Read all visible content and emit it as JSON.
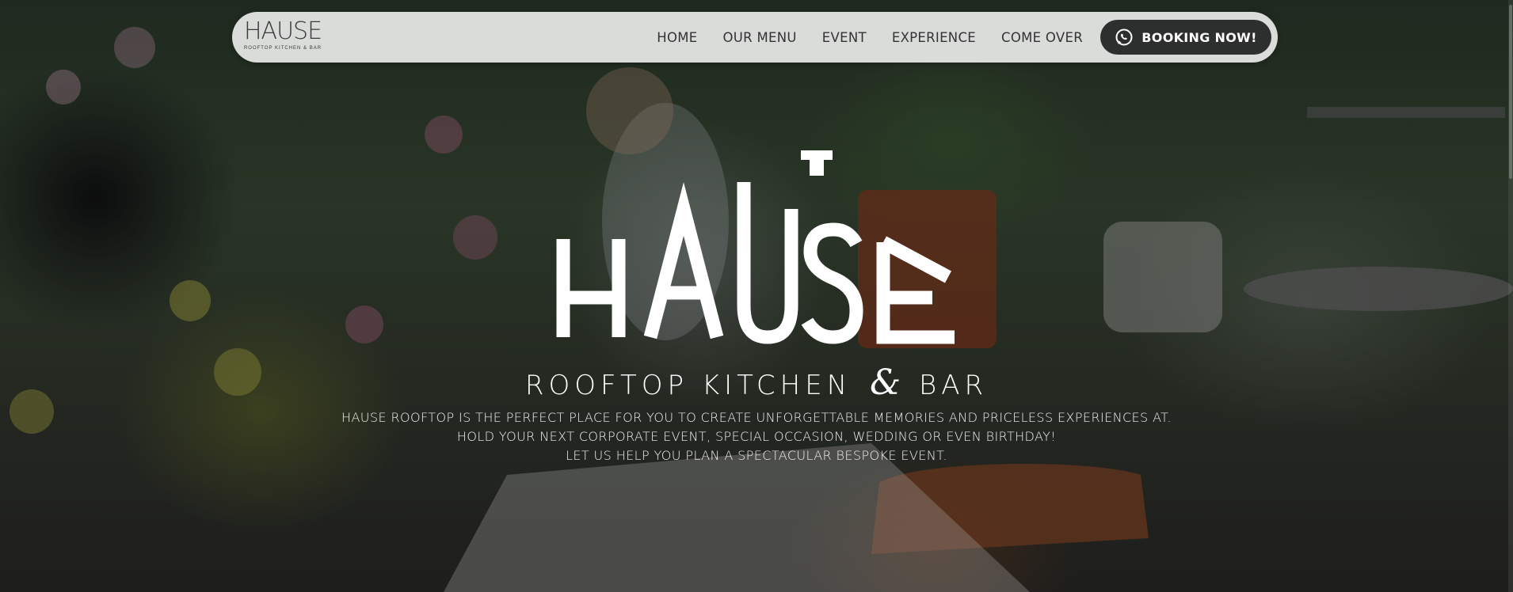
{
  "brand": {
    "name": "HAUSE",
    "tagline_prefix": "ROOFTOP KITCHEN",
    "tagline_amp": "&",
    "tagline_suffix": "BAR",
    "nav_tagline": "ROOFTOP KITCHEN & BAR"
  },
  "nav": {
    "links": [
      "HOME",
      "OUR MENU",
      "EVENT",
      "EXPERIENCE",
      "COME OVER"
    ],
    "booking_label": "BOOKING NOW!",
    "booking_icon": "whatsapp-icon"
  },
  "hero": {
    "description": [
      "HAUSE ROOFTOP IS THE PERFECT PLACE FOR YOU TO CREATE UNFORGETTABLE MEMORIES AND PRICELESS EXPERIENCES AT.",
      "HOLD YOUR NEXT CORPORATE EVENT, SPECIAL OCCASION, WEDDING OR EVEN BIRTHDAY!",
      "LET US HELP YOU PLAN A SPECTACULAR BESPOKE EVENT."
    ]
  },
  "colors": {
    "navbar_bg": "#e8e9e8",
    "button_bg": "#2d2f2e",
    "text_dark": "#333333",
    "text_light": "#ffffff"
  }
}
